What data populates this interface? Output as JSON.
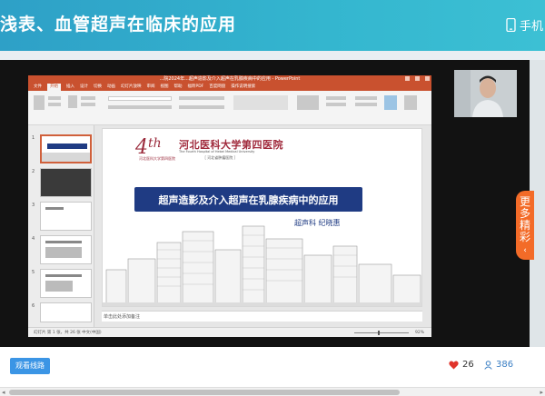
{
  "header": {
    "title": "浅表、血管超声在临床的应用",
    "phone_label": "手机"
  },
  "ppt": {
    "window_title": "...院2024年...超声造影及介入超声在乳腺疾病中的应用 - PowerPoint",
    "menu": [
      "文件",
      "开始",
      "插入",
      "设计",
      "切换",
      "动画",
      "幻灯片放映",
      "审阅",
      "视图",
      "帮助",
      "福昕PDF",
      "百度网盘",
      "操作说明搜索"
    ],
    "active_menu_index": 1,
    "slide": {
      "logo_number": "4",
      "logo_suffix": "th",
      "logo_caption": "河北医科大学第四医院",
      "hospital_name": "河北医科大学第四医院",
      "hospital_english": "The Fourth Hospital of Hebei Medical University",
      "motto": "［ 河北省肿瘤医院 ］",
      "banner_title": "超声造影及介入超声在乳腺疾病中的应用",
      "authors": "超声科   纪晓惠"
    },
    "notes_placeholder": "单击此处添加备注",
    "status_text": "幻灯片 第 1 张，共 26 张   中文(中国)",
    "zoom_label": "92%",
    "thumb_numbers": [
      "1",
      "2",
      "3",
      "4",
      "5",
      "6"
    ]
  },
  "side_tab": {
    "label": "更多精彩"
  },
  "footer": {
    "watch_button": "观看线路",
    "likes": "26",
    "viewers": "386"
  },
  "colors": {
    "header_gradient_start": "#2ea0c7",
    "ppt_accent": "#c9512f",
    "banner": "#1f3b83",
    "hospital_red": "#a02a3c",
    "more_tab": "#f36b28",
    "watch_button": "#3b95e5",
    "heart": "#e0342b"
  }
}
